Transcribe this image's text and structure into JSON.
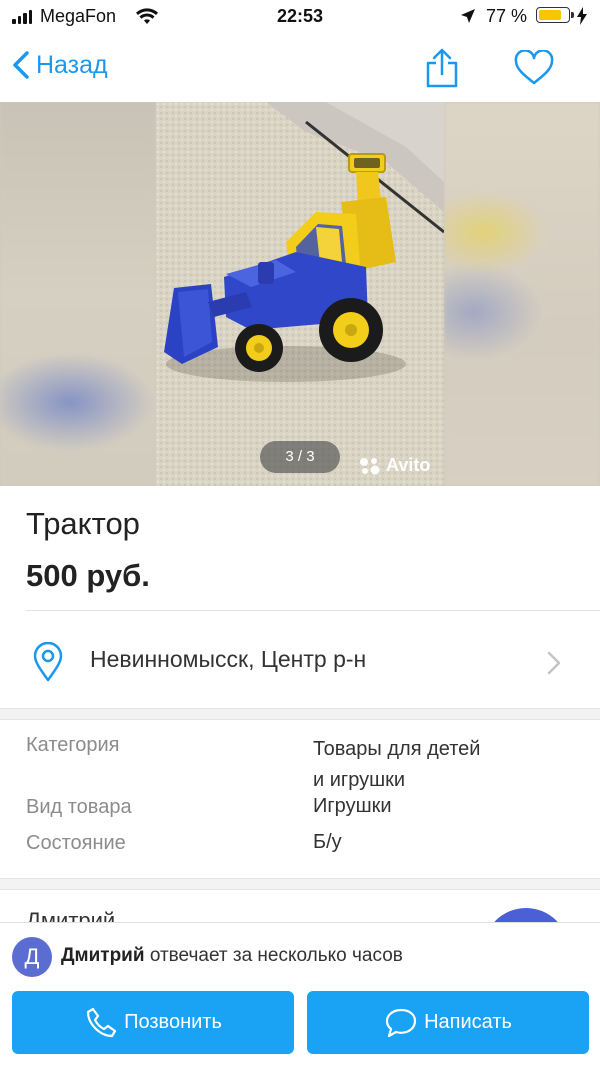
{
  "status_bar": {
    "carrier": "MegaFon",
    "time": "22:53",
    "battery_percent": "77 %",
    "battery_level": 0.77
  },
  "nav": {
    "back_label": "Назад"
  },
  "gallery": {
    "counter": "3 / 3",
    "watermark": "Avito"
  },
  "listing": {
    "title": "Трактор",
    "price": "500 руб.",
    "location": "Невинномысск, Центр р-н"
  },
  "params": [
    {
      "label": "Категория",
      "value": "Товары для детей\nи игрушки"
    },
    {
      "label": "Вид товара",
      "value": "Игрушки"
    },
    {
      "label": "Состояние",
      "value": "Б/у"
    }
  ],
  "seller": {
    "peek_name": "Дмитрий",
    "avatar_letter": "Д",
    "name": "Дмитрий",
    "response_text": " отвечает за несколько часов"
  },
  "actions": {
    "call_label": "Позвонить",
    "write_label": "Написать"
  },
  "colors": {
    "accent": "#1a98ee",
    "button": "#1aa3f5",
    "avatar": "#5b6dd0"
  }
}
